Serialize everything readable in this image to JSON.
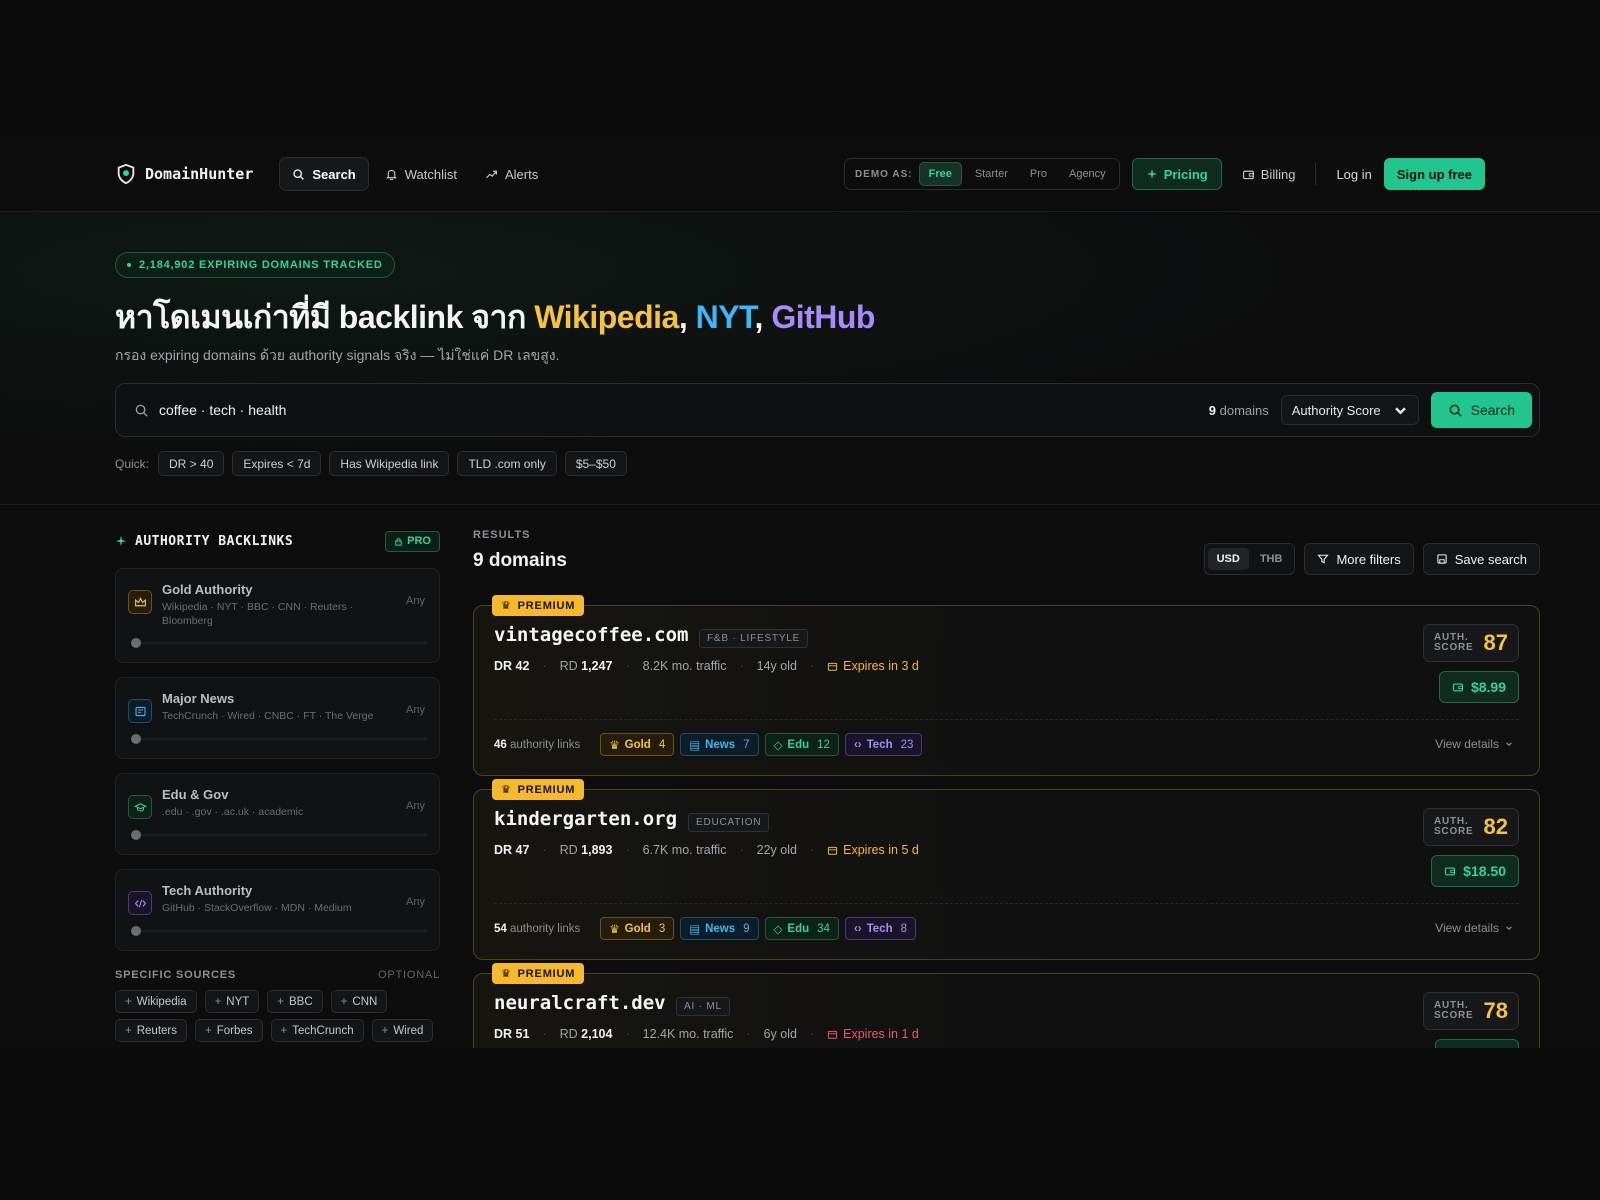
{
  "nav": {
    "logo": "DomainHunter",
    "items": [
      {
        "label": "Search",
        "icon": "search-icon"
      },
      {
        "label": "Watchlist",
        "icon": "bell-icon"
      },
      {
        "label": "Alerts",
        "icon": "trend-icon"
      }
    ],
    "demo_label": "DEMO AS:",
    "demo_options": [
      "Free",
      "Starter",
      "Pro",
      "Agency"
    ],
    "demo_selected": "Free",
    "pricing": "Pricing",
    "billing": "Billing",
    "login": "Log in",
    "signup": "Sign up free"
  },
  "hero": {
    "badge": "2,184,902 EXPIRING DOMAINS TRACKED",
    "headline_prefix": "หาโดเมนเก่าที่มี backlink จาก ",
    "headline_wiki": "Wikipedia",
    "headline_nyt": "NYT",
    "headline_gh": "GitHub",
    "comma": ",",
    "subline": "กรอง expiring domains ด้วย authority signals จริง — ไม่ใช่แค่ DR เลขสูง.",
    "search": {
      "query": "coffee · tech · health",
      "count": "9",
      "count_suffix": " domains",
      "sort": "Authority Score",
      "button": "Search"
    },
    "quick_label": "Quick:",
    "quick_chips": [
      "DR > 40",
      "Expires < 7d",
      "Has Wikipedia link",
      "TLD .com only",
      "$5–$50"
    ]
  },
  "sidebar": {
    "title": "AUTHORITY BACKLINKS",
    "pro": "PRO",
    "cards": [
      {
        "title": "Gold Authority",
        "sub": "Wikipedia · NYT · BBC · CNN · Reuters · Bloomberg",
        "value": "Any",
        "color": "#f5c242"
      },
      {
        "title": "Major News",
        "sub": "TechCrunch · Wired · CNBC · FT · The Verge",
        "value": "Any",
        "color": "#3fb6f5"
      },
      {
        "title": "Edu & Gov",
        "sub": ".edu · .gov · .ac.uk · academic",
        "value": "Any",
        "color": "#34d399"
      },
      {
        "title": "Tech Authority",
        "sub": "GitHub · StackOverflow · MDN · Medium",
        "value": "Any",
        "color": "#a78bfa"
      }
    ],
    "sources_title": "SPECIFIC SOURCES",
    "sources_optional": "OPTIONAL",
    "sources": [
      "Wikipedia",
      "NYT",
      "BBC",
      "CNN",
      "Reuters",
      "Forbes",
      "TechCrunch",
      "Wired"
    ]
  },
  "results": {
    "label": "RESULTS",
    "title": "9 domains",
    "currency": [
      "USD",
      "THB"
    ],
    "currency_selected": "USD",
    "more_filters": "More filters",
    "save_search": "Save search",
    "premium_label": "PREMIUM",
    "auth_label_1": "AUTH.",
    "auth_label_2": "SCORE",
    "view_details": "View details",
    "authority_links_suffix": "authority links",
    "domains": [
      {
        "name": "vintagecoffee.com",
        "category": "F&B · LIFESTYLE",
        "dr_label": "DR",
        "dr": "42",
        "rd_label": "RD",
        "rd": "1,247",
        "traffic": "8.2K mo. traffic",
        "age": "14y old",
        "expires": "Expires in 3 d",
        "urgent": false,
        "score": "87",
        "price": "$8.99",
        "links": "46",
        "gold": "4",
        "news": "7",
        "edu": "12",
        "tech": "23"
      },
      {
        "name": "kindergarten.org",
        "category": "EDUCATION",
        "dr_label": "DR",
        "dr": "47",
        "rd_label": "RD",
        "rd": "1,893",
        "traffic": "6.7K mo. traffic",
        "age": "22y old",
        "expires": "Expires in 5 d",
        "urgent": false,
        "score": "82",
        "price": "$18.50",
        "links": "54",
        "gold": "3",
        "news": "9",
        "edu": "34",
        "tech": "8"
      },
      {
        "name": "neuralcraft.dev",
        "category": "AI · ML",
        "dr_label": "DR",
        "dr": "51",
        "rd_label": "RD",
        "rd": "2,104",
        "traffic": "12.4K mo. traffic",
        "age": "6y old",
        "expires": "Expires in 1 d",
        "urgent": true,
        "score": "78",
        "price": "",
        "links": "",
        "gold": "",
        "news": "",
        "edu": "",
        "tech": ""
      }
    ],
    "chip_labels": {
      "gold": "Gold",
      "news": "News",
      "edu": "Edu",
      "tech": "Tech"
    }
  }
}
